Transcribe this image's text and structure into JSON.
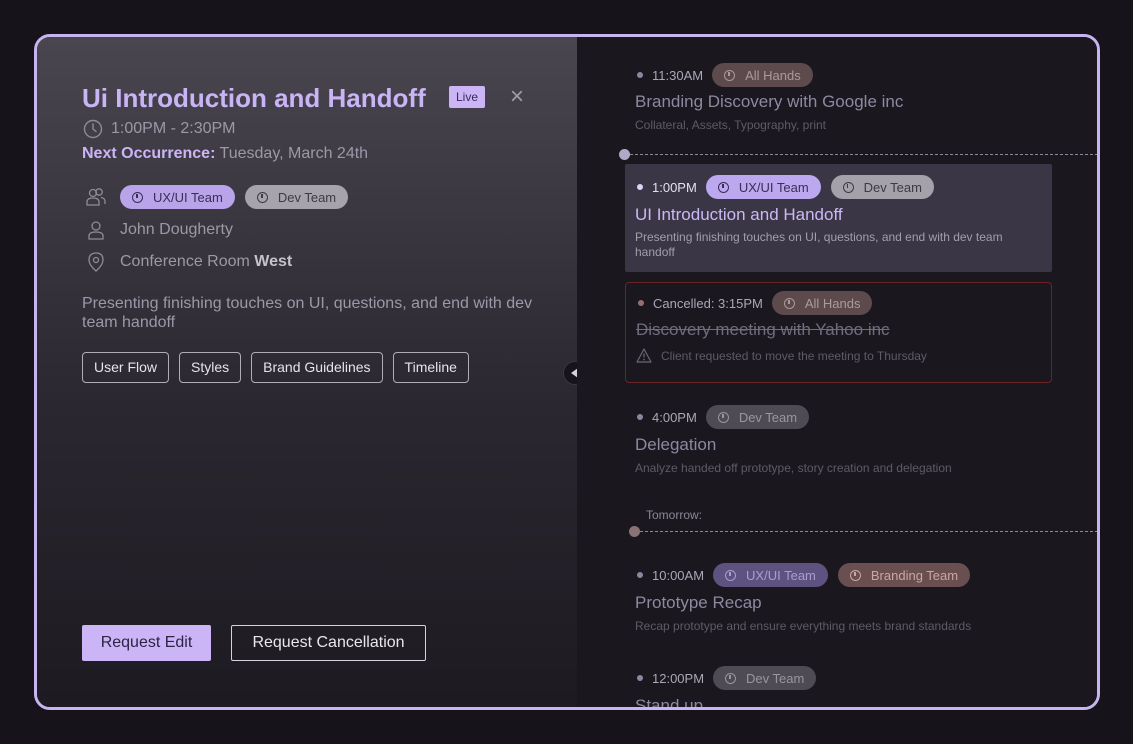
{
  "details": {
    "title": "Ui Introduction and Handoff",
    "live_badge": "Live",
    "close_icon": "close-icon",
    "time": "1:00PM - 2:30PM",
    "next_label": "Next Occurrence:",
    "next_value": "Tuesday, March 24th",
    "teams": [
      "UX/UI Team",
      "Dev Team"
    ],
    "organizer": "John Dougherty",
    "location_prefix": "Conference Room",
    "location_bold": "West",
    "description": "Presenting finishing touches on UI, questions, and end with dev team handoff",
    "attachments": [
      "User Flow",
      "Styles",
      "Brand Guidelines",
      "Timeline"
    ],
    "primary_action": "Request Edit",
    "secondary_action": "Request Cancellation"
  },
  "timeline": {
    "events": [
      {
        "time": "11:30AM",
        "tags": [
          "All Hands"
        ],
        "title": "Branding Discovery with Google inc",
        "desc": "Collateral, Assets, Typography, print"
      },
      {
        "time": "1:00PM",
        "tags": [
          "UX/UI Team",
          "Dev Team"
        ],
        "title": "UI Introduction and Handoff",
        "desc": "Presenting finishing touches on UI, questions, and end with dev team handoff"
      },
      {
        "time": "Cancelled: 3:15PM",
        "tags": [
          "All Hands"
        ],
        "title": "Discovery meeting with Yahoo inc",
        "desc": "Client requested to move the meeting to Thursday"
      },
      {
        "time": "4:00PM",
        "tags": [
          "Dev Team"
        ],
        "title": "Delegation",
        "desc": "Analyze handed off prototype, story creation and delegation"
      },
      {
        "time": "10:00AM",
        "tags": [
          "UX/UI Team",
          "Branding Team"
        ],
        "title": "Prototype Recap",
        "desc": "Recap prototype and ensure everything meets brand standards"
      },
      {
        "time": "12:00PM",
        "tags": [
          "Dev Team"
        ],
        "title": "Stand up",
        "desc": ""
      }
    ],
    "tomorrow_label": "Tomorrow:"
  },
  "colors": {
    "accent": "#cbb5f7",
    "frame_border": "#c6b5f0",
    "background": "#16131b",
    "cancel_border": "#6b2426"
  }
}
